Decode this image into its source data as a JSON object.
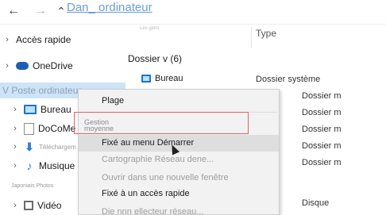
{
  "toolbar": {
    "back_glyph": "←",
    "forward_glyph": "→",
    "up_glyph": "⌃",
    "address_text": "Dan_ ordinateur"
  },
  "sidebar": {
    "items": [
      {
        "label": "Accès rapide"
      },
      {
        "label": "OneDrive"
      },
      {
        "label": "V Poste ordinateur"
      },
      {
        "label": "Bureau"
      },
      {
        "label": "DoCoMe"
      },
      {
        "label": "Téléchargem"
      },
      {
        "label": "Musique"
      },
      {
        "label": "Japoniais Photos"
      },
      {
        "label": "Vidéo"
      }
    ]
  },
  "content": {
    "column_type": "Type",
    "ghost_text": "Les gens",
    "group_header": "Dossier v (6)",
    "rows": [
      {
        "name": "Bureau",
        "type": "Dossier système"
      },
      {
        "type": "Dossier m"
      },
      {
        "type": "Dossier m"
      },
      {
        "type": "Dossier m"
      },
      {
        "type": "Dossier m"
      },
      {
        "type": "Dossier m"
      },
      {
        "type": "Disque"
      }
    ]
  },
  "context_menu": {
    "items": [
      {
        "label": "Plage"
      },
      {
        "label": "Gestion"
      },
      {
        "label": "moyenne"
      },
      {
        "label": "Fixé au menu Démarrer"
      },
      {
        "label": "Cartographie Réseau dene..."
      },
      {
        "label": "Ouvrir dans une nouvelle fenêtre"
      },
      {
        "label": "Fixé à un accès rapide"
      },
      {
        "label": "Die nnn ellecteur réseau..."
      }
    ]
  },
  "colors": {
    "accent": "#6a9ed6",
    "selection": "#cde4f7",
    "highlight_frame": "#e06060",
    "menu_bg": "#f2f2f2"
  }
}
